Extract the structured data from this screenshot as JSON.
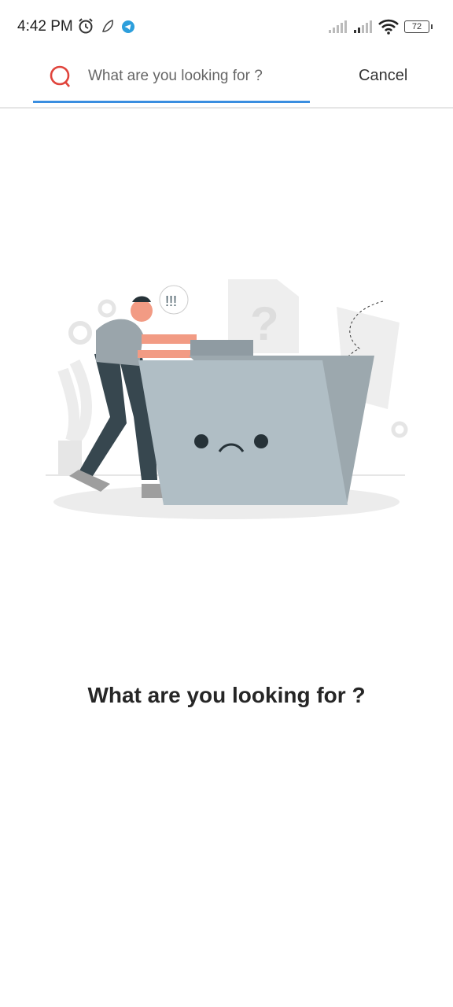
{
  "status_bar": {
    "time": "4:42 PM",
    "battery": "72",
    "icons": [
      "alarm-icon",
      "app-notification-icon",
      "telegram-icon",
      "signal-icon",
      "signal-icon",
      "wifi-icon",
      "battery-icon"
    ]
  },
  "search": {
    "placeholder": "What are you looking for ?",
    "value": "",
    "cancel_label": "Cancel",
    "accent": "#3a8ee0",
    "icon_color": "#e0443c"
  },
  "empty_state": {
    "title": "What are you looking for ?",
    "illustration_text": "!!!"
  }
}
